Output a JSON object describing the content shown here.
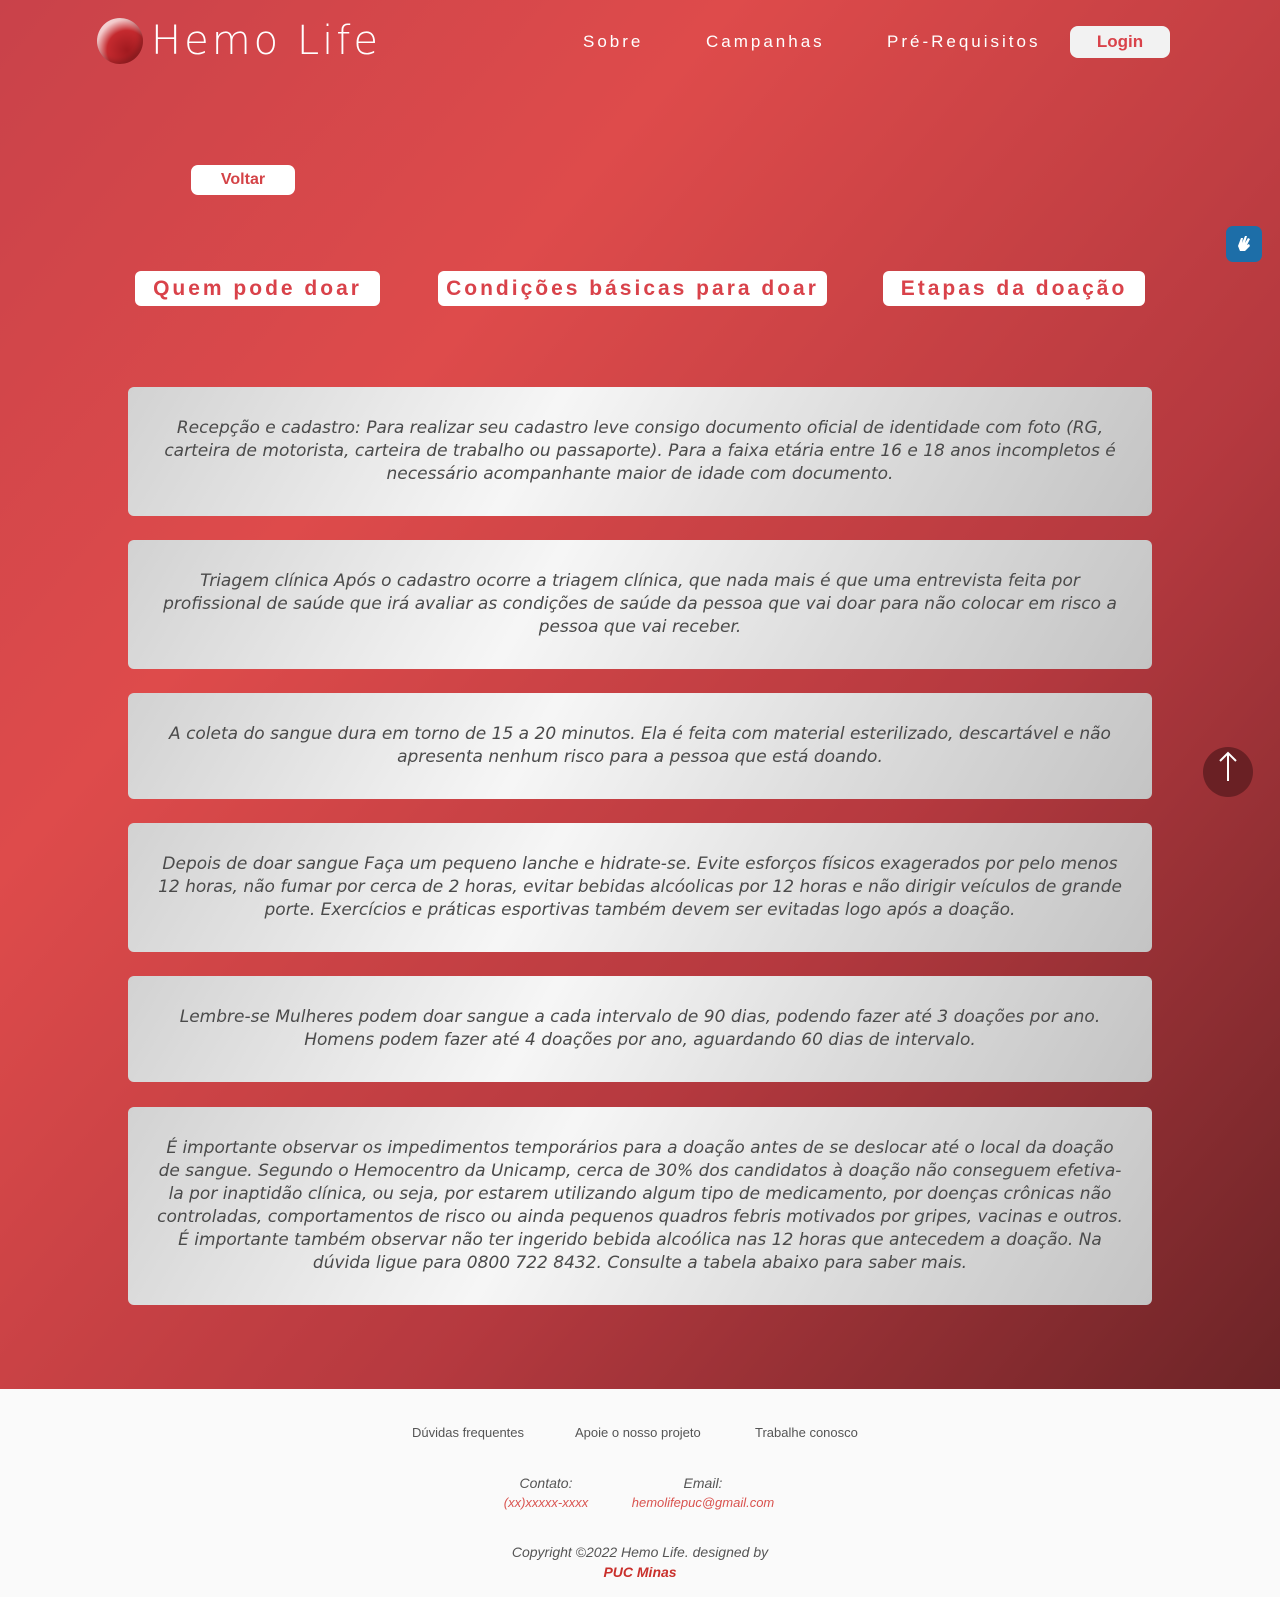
{
  "header": {
    "brand": "Hemo Life",
    "nav": [
      "Sobre",
      "Campanhas",
      "Pré-Requisitos"
    ],
    "login_label": "Login"
  },
  "back_label": "Voltar",
  "tabs": [
    "Quem pode doar",
    "Condições básicas para doar",
    "Etapas da doação"
  ],
  "cards": [
    "Recepção e cadastro: Para realizar seu cadastro leve consigo documento oficial de identidade com foto (RG, carteira de motorista, carteira de trabalho ou passaporte). Para a faixa etária entre 16 e 18 anos incompletos é necessário acompanhante maior de idade com documento.",
    "Triagem clínica Após o cadastro ocorre a triagem clínica, que nada mais é que uma entrevista feita por profissional de saúde que irá avaliar as condições de saúde da pessoa que vai doar para não colocar em risco a pessoa que vai receber.",
    "A coleta do sangue dura em torno de 15 a 20 minutos. Ela é feita com material esterilizado, descartável e não apresenta nenhum risco para a pessoa que está doando.",
    "Depois de doar sangue Faça um pequeno lanche e hidrate-se. Evite esforços físicos exagerados por pelo menos 12 horas, não fumar por cerca de 2 horas, evitar bebidas alcóolicas por 12 horas e não dirigir veículos de grande porte. Exercícios e práticas esportivas também devem ser evitadas logo após a doação.",
    "Lembre-se Mulheres podem doar sangue a cada intervalo de 90 dias, podendo fazer até 3 doações por ano. Homens podem fazer até 4 doações por ano, aguardando 60 dias de intervalo.",
    "É importante observar os impedimentos temporários para a doação antes de se deslocar até o local da doação de sangue. Segundo o Hemocentro da Unicamp, cerca de 30% dos candidatos à doação não conseguem efetiva-la por inaptidão clínica, ou seja, por estarem utilizando algum tipo de medicamento, por doenças crônicas não controladas, comportamentos de risco ou ainda pequenos quadros febris motivados por gripes, vacinas e outros. É importante também observar não ter ingerido bebida alcoólica nas 12 horas que antecedem a doação. Na dúvida ligue para 0800 722 8432. Consulte a tabela abaixo para saber mais."
  ],
  "icons": {
    "accessibility": "sign-language-hands-icon",
    "scroll_top": "arrow-up-icon",
    "logo": "blood-drop-logo-icon"
  },
  "footer": {
    "links": [
      "Dúvidas frequentes",
      "Apoie o nosso projeto",
      "Trabalhe conosco"
    ],
    "contact_label": "Contato:",
    "contact_value": "(xx)xxxxx-xxxx",
    "email_label": "Email:",
    "email_value": "hemolifepuc@gmail.com",
    "copyright": "Copyright ©2022 Hemo Life. designed by",
    "designer": "PUC Minas"
  },
  "colors": {
    "accent": "#d9424a",
    "hero_start": "#c9424a",
    "hero_end": "#6c2427",
    "accessibility_bg": "#1d6ea8"
  }
}
